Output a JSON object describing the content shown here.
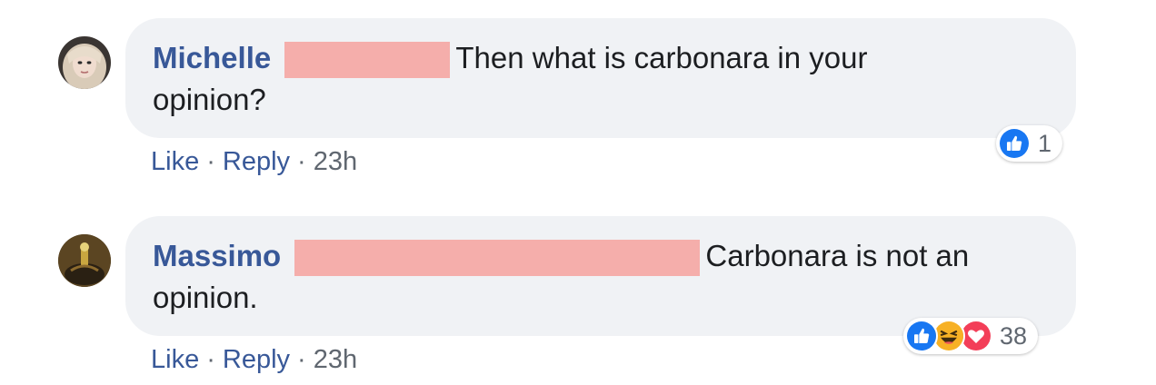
{
  "comments": [
    {
      "author": "Michelle",
      "text_line1": "Then what is carbonara in your",
      "text_line2": "opinion?",
      "actions": {
        "like": "Like",
        "reply": "Reply",
        "time": "23h"
      },
      "reactions": {
        "icons": [
          "like-icon"
        ],
        "count": "1"
      }
    },
    {
      "author": "Massimo",
      "text_line1": "Carbonara is not an",
      "text_line2": "opinion.",
      "actions": {
        "like": "Like",
        "reply": "Reply",
        "time": "23h"
      },
      "reactions": {
        "icons": [
          "like-icon",
          "haha-icon",
          "love-icon"
        ],
        "count": "38"
      }
    }
  ],
  "separator": "·",
  "colors": {
    "link": "#385898",
    "bubble": "#f0f2f5",
    "like_blue": "#1877f2",
    "love_red": "#f33e58",
    "haha_yellow": "#f7b125",
    "redaction": "#f5aeab"
  }
}
